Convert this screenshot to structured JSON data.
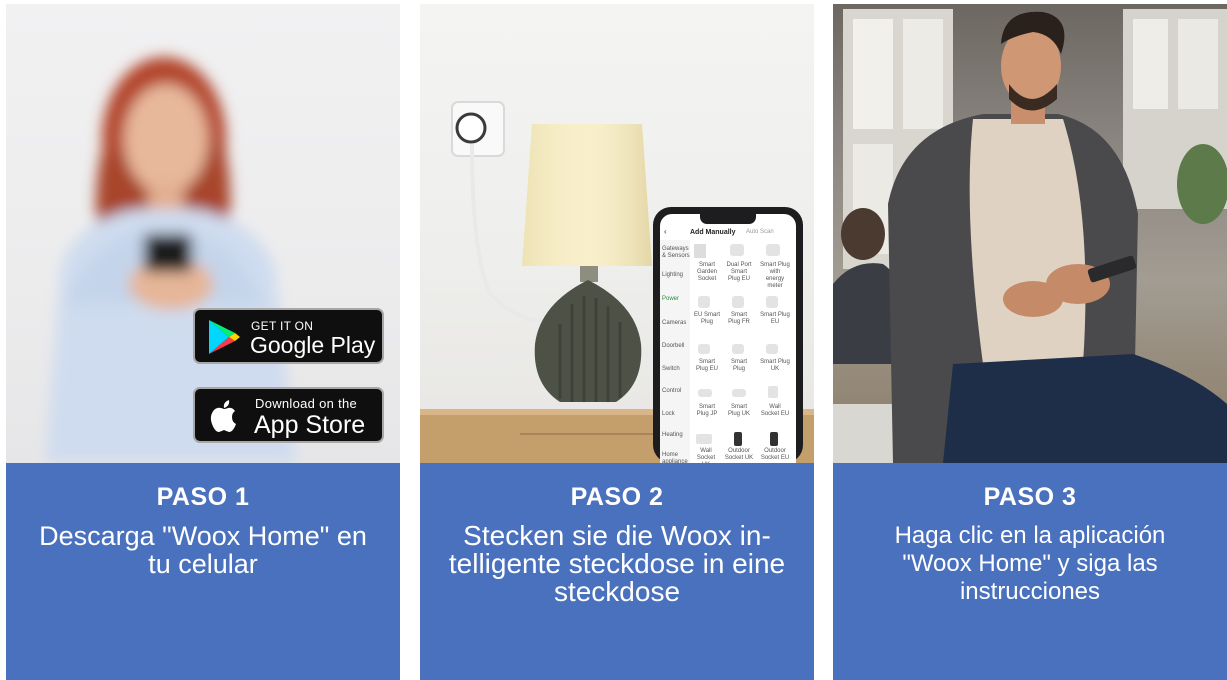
{
  "steps": [
    {
      "title": "PASO 1",
      "description": "Descarga \"Woox Home\" en tu celular",
      "badges": {
        "google_play": {
          "small": "GET IT ON",
          "big": "Google Play"
        },
        "app_store": {
          "small": "Download on the",
          "big": "App Store"
        }
      }
    },
    {
      "title": "PASO 2",
      "description": "Stecken sie die Woox in-telligente steckdose in eine steckdose",
      "phone": {
        "header_title": "Add Manually",
        "header_right": "Auto Scan",
        "categories": [
          "Gateways & Sensors",
          "Lighting",
          "Power",
          "Cameras",
          "Doorbell",
          "Switch",
          "Control",
          "Lock",
          "Heating",
          "Home appliance"
        ],
        "devices": [
          "Smart Garden Socket",
          "Dual Port Smart Plug EU",
          "Smart Plug with energy meter",
          "EU Smart Plug",
          "Smart Plug FR",
          "Smart Plug EU",
          "Smart Plug EU",
          "Smart Plug",
          "Smart Plug UK",
          "Smart Plug JP",
          "Smart Plug UK",
          "Wall Socket EU",
          "Wall Socket UK",
          "Outdoor Socket UK",
          "Outdoor Socket EU"
        ]
      }
    },
    {
      "title": "PASO 3",
      "description": "Haga clic en la aplicación \"Woox Home\" y siga las instrucciones"
    }
  ],
  "colors": {
    "caption_bg": "#4a71bd",
    "caption_text": "#ffffff"
  }
}
